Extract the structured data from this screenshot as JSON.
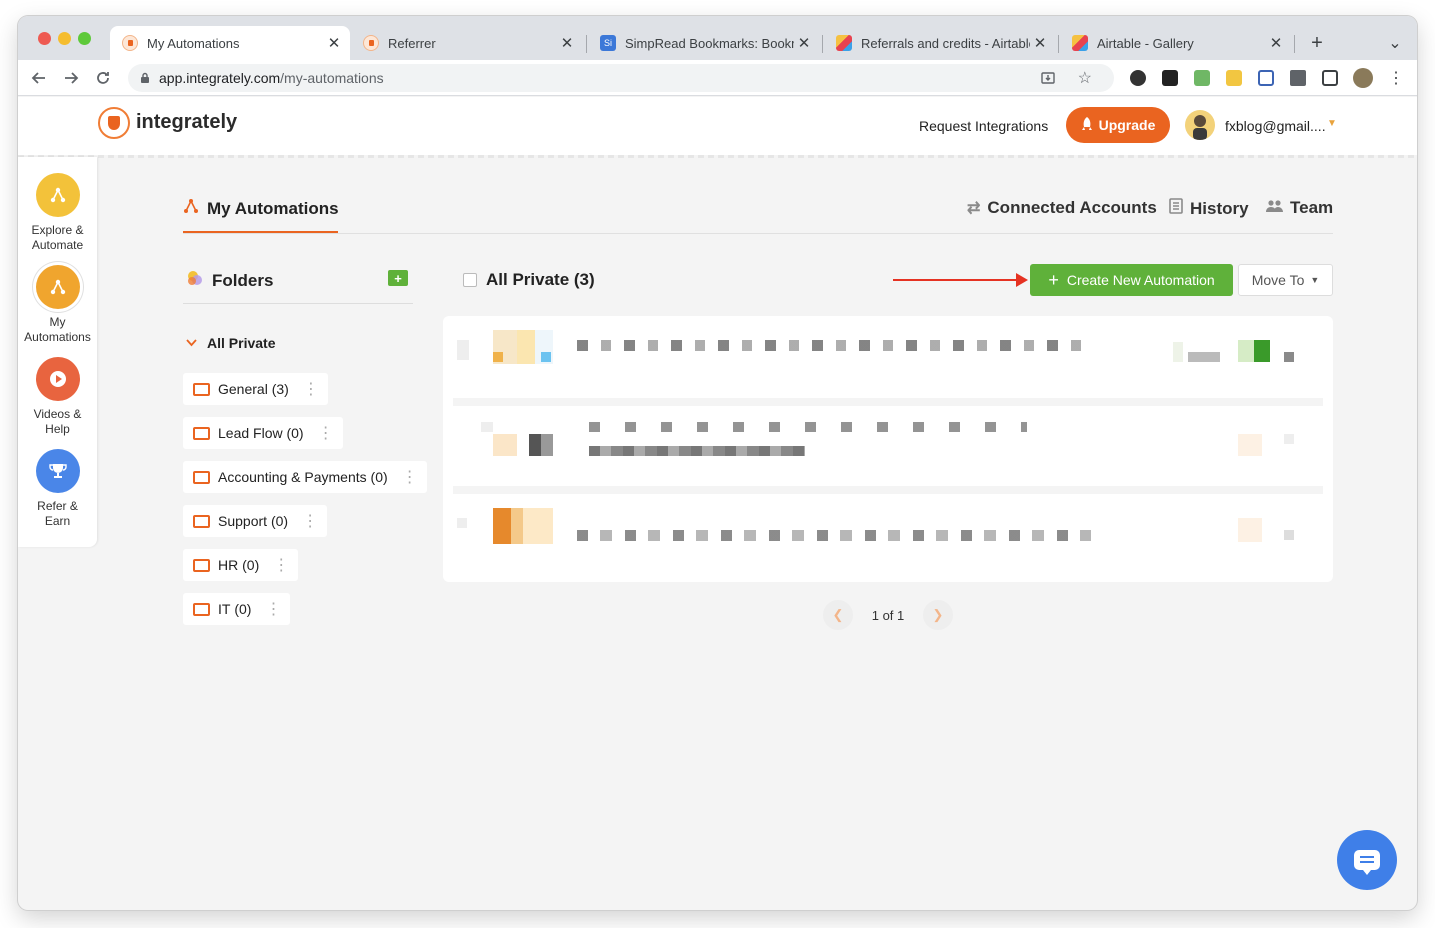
{
  "browser": {
    "tabs": [
      {
        "title": "My Automations",
        "active": true
      },
      {
        "title": "Referrer",
        "active": false
      },
      {
        "title": "SimpRead Bookmarks: Bookma",
        "active": false
      },
      {
        "title": "Referrals and credits - Airtable",
        "active": false
      },
      {
        "title": "Airtable - Gallery",
        "active": false
      }
    ],
    "url_host": "app.integrately.com",
    "url_path": "/my-automations",
    "new_tab": "+",
    "tab_overflow": "⌄"
  },
  "header": {
    "logo": "integrately",
    "request_integrations": "Request Integrations",
    "upgrade": "Upgrade",
    "user_email": "fxblog@gmail...."
  },
  "rail": {
    "items": [
      {
        "label1": "Explore &",
        "label2": "Automate",
        "icon": "share-nodes-icon",
        "color": "#f3c23a"
      },
      {
        "label1": "My",
        "label2": "Automations",
        "icon": "share-nodes-icon",
        "color": "#f0a52e"
      },
      {
        "label1": "Videos &",
        "label2": "Help",
        "icon": "play-icon",
        "color": "#e8643f"
      },
      {
        "label1": "Refer &",
        "label2": "Earn",
        "icon": "trophy-icon",
        "color": "#4a86e8"
      }
    ]
  },
  "main": {
    "active_tab": "My Automations",
    "links": {
      "connected_accounts": "Connected Accounts",
      "history": "History",
      "team": "Team"
    },
    "folders_title": "Folders",
    "group_label": "All Private",
    "folders": [
      {
        "name": "General",
        "count": "(3)"
      },
      {
        "name": "Lead Flow",
        "count": "(0)"
      },
      {
        "name": "Accounting & Payments",
        "count": "(0)"
      },
      {
        "name": "Support",
        "count": "(0)"
      },
      {
        "name": "HR",
        "count": "(0)"
      },
      {
        "name": "IT",
        "count": "(0)"
      }
    ],
    "list_title": "All Private (3)",
    "create_button": "Create New Automation",
    "move_to": "Move To",
    "pagination": "1 of 1"
  },
  "colors": {
    "brand_orange": "#ea6420",
    "create_green": "#5fb13a",
    "annotation_arrow": "#e53222",
    "chat_blue": "#3f7fe8"
  }
}
